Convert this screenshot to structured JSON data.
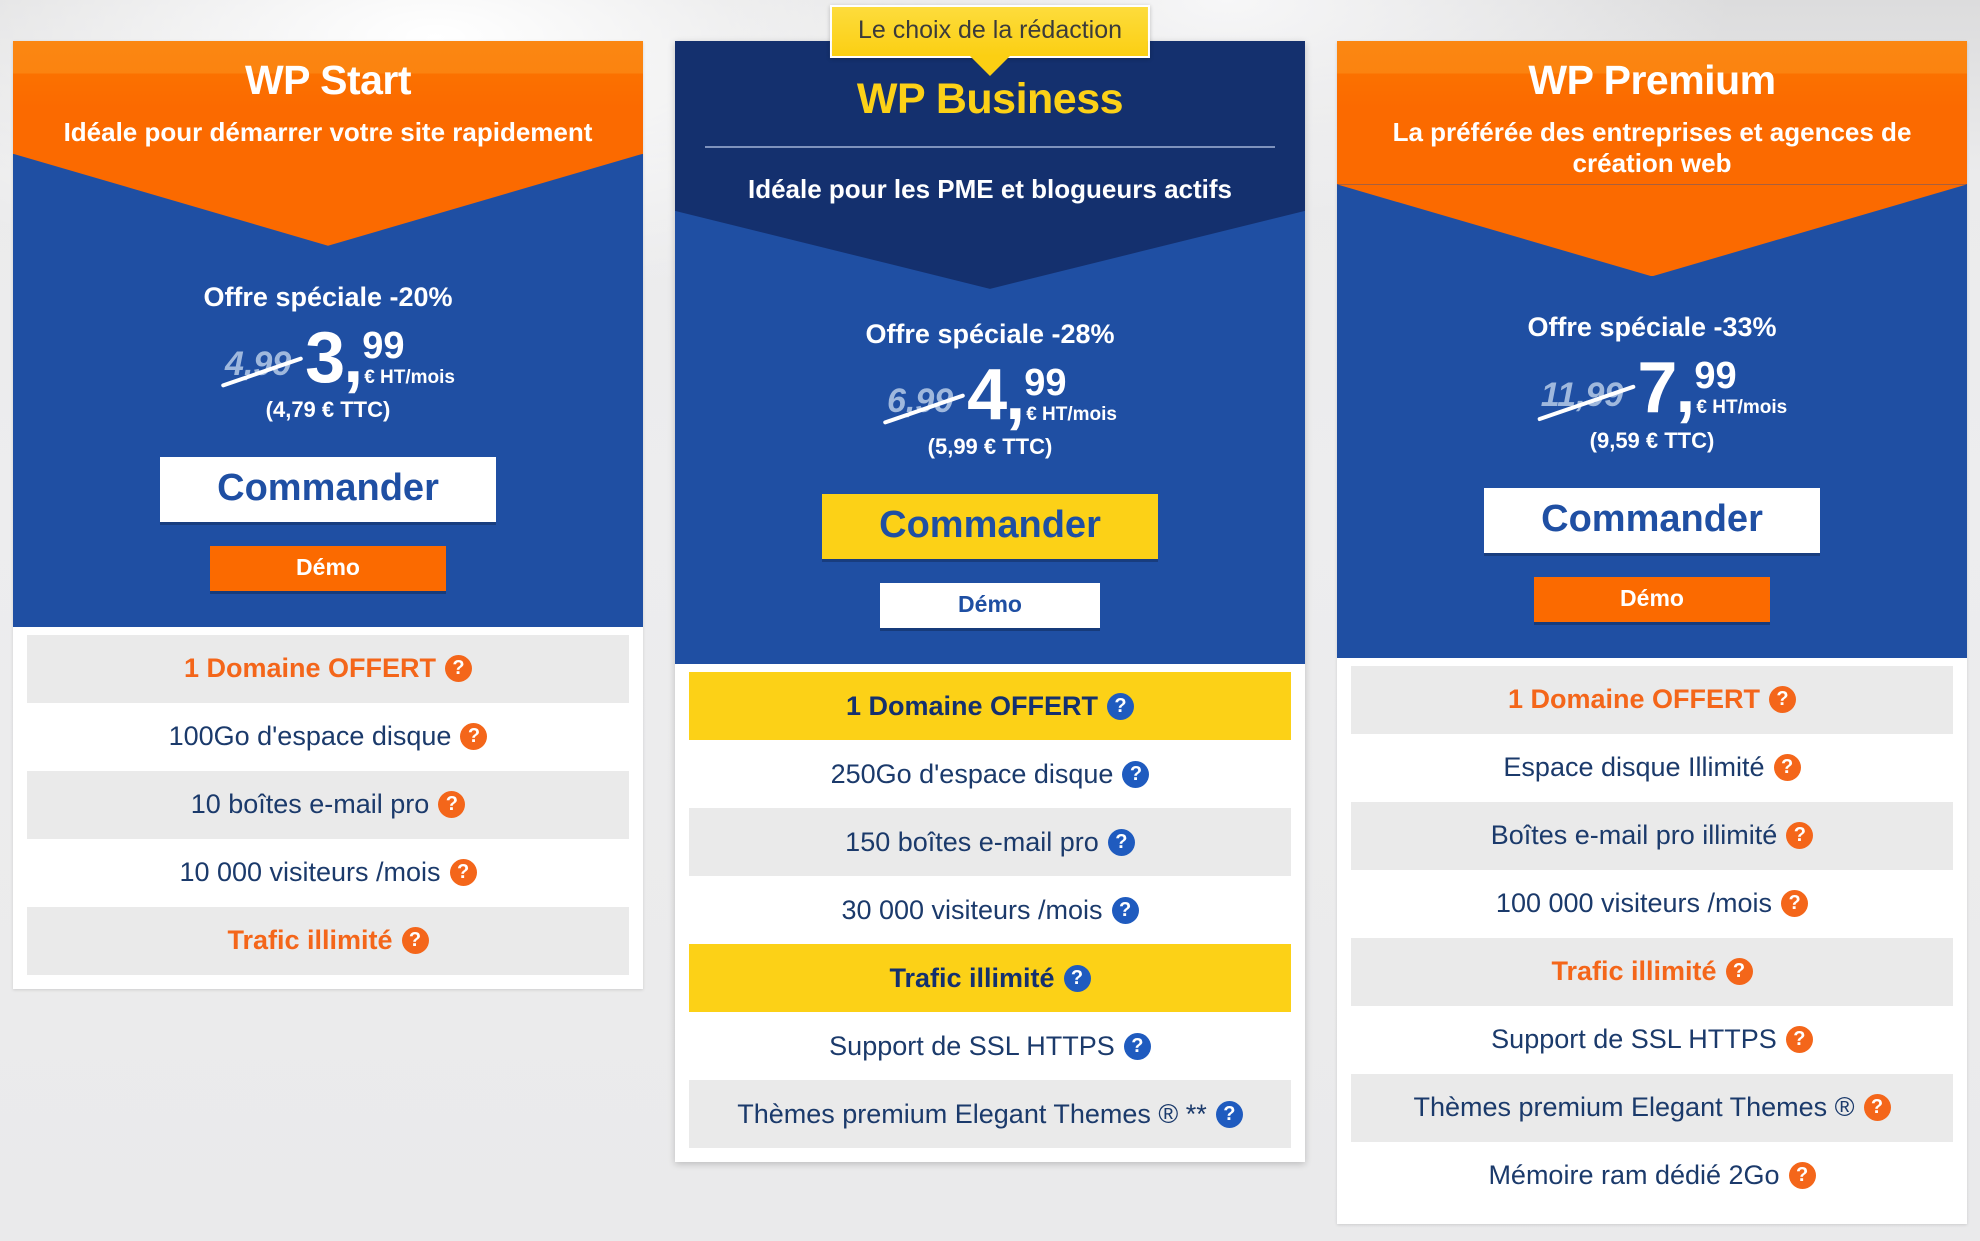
{
  "badge": {
    "label": "Le choix de la rédaction"
  },
  "plans": [
    {
      "id": "wp-start",
      "name": "WP Start",
      "tagline": "Idéale pour démarrer votre site rapidement",
      "offer": "Offre spéciale -20%",
      "old_price": "4,99",
      "price_int": "3,",
      "price_cents": "99",
      "price_unit": "€ HT/mois",
      "price_ttc": "(4,79 € TTC)",
      "order_label": "Commander",
      "demo_label": "Démo",
      "features": [
        {
          "text": "1 Domaine OFFERT",
          "style": "hl"
        },
        {
          "text": "100Go d'espace disque",
          "style": "plain"
        },
        {
          "text": "10 boîtes e-mail pro",
          "style": "alt"
        },
        {
          "text": "10 000 visiteurs /mois",
          "style": "plain"
        },
        {
          "text": "Trafic illimité",
          "style": "hl"
        }
      ]
    },
    {
      "id": "wp-business",
      "name": "WP Business",
      "tagline": "Idéale pour les PME et blogueurs actifs",
      "offer": "Offre spéciale -28%",
      "old_price": "6,99",
      "price_int": "4,",
      "price_cents": "99",
      "price_unit": "€ HT/mois",
      "price_ttc": "(5,99 € TTC)",
      "order_label": "Commander",
      "demo_label": "Démo",
      "features": [
        {
          "text": "1 Domaine OFFERT",
          "style": "hl"
        },
        {
          "text": "250Go d'espace disque",
          "style": "plain"
        },
        {
          "text": "150 boîtes e-mail pro",
          "style": "alt"
        },
        {
          "text": "30 000 visiteurs /mois",
          "style": "plain"
        },
        {
          "text": "Trafic illimité",
          "style": "hl"
        },
        {
          "text": "Support de SSL HTTPS",
          "style": "plain"
        },
        {
          "text": "Thèmes premium Elegant Themes ® **",
          "style": "alt"
        }
      ]
    },
    {
      "id": "wp-premium",
      "name": "WP Premium",
      "tagline": "La préférée des entreprises et agences de création web",
      "offer": "Offre spéciale -33%",
      "old_price": "11,99",
      "price_int": "7,",
      "price_cents": "99",
      "price_unit": "€ HT/mois",
      "price_ttc": "(9,59 € TTC)",
      "order_label": "Commander",
      "demo_label": "Démo",
      "features": [
        {
          "text": "1 Domaine OFFERT",
          "style": "hl"
        },
        {
          "text": "Espace disque Illimité",
          "style": "plain"
        },
        {
          "text": "Boîtes e-mail pro illimité",
          "style": "alt"
        },
        {
          "text": "100 000 visiteurs /mois",
          "style": "plain"
        },
        {
          "text": "Trafic illimité",
          "style": "hl"
        },
        {
          "text": "Support de SSL HTTPS",
          "style": "plain"
        },
        {
          "text": "Thèmes premium Elegant Themes ®",
          "style": "alt"
        },
        {
          "text": "Mémoire ram dédié 2Go",
          "style": "plain"
        }
      ]
    }
  ],
  "icons": {
    "help": "?"
  },
  "colors": {
    "orange": "#fb6a00",
    "orange_light": "#fb8712",
    "accent_orange": "#f4661a",
    "blue": "#1f4fa3",
    "navy": "#14306e",
    "yellow": "#fcd117",
    "row_alt": "#eaeaea",
    "text_blue": "#1b3a6b"
  }
}
